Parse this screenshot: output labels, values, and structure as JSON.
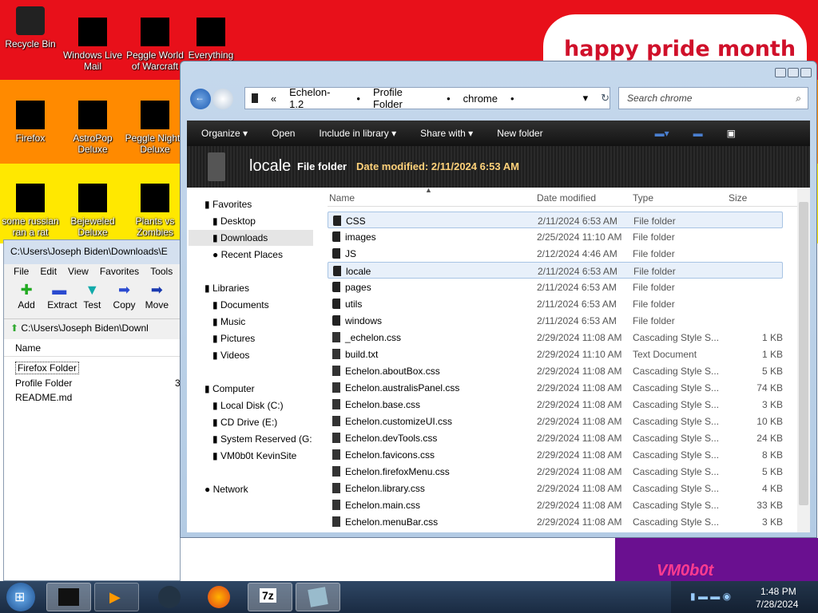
{
  "desktop": {
    "icons": [
      {
        "label": "Recycle Bin"
      },
      {
        "label": "Windows Live Mail"
      },
      {
        "label": "Peggle World of Warcraft"
      },
      {
        "label": "Everything"
      },
      {
        "label": "Firefox"
      },
      {
        "label": "AstroPop Deluxe"
      },
      {
        "label": "Peggle Nights Deluxe"
      },
      {
        "label": "some russian ran a rat"
      },
      {
        "label": "Bejeweled Deluxe"
      },
      {
        "label": "Plants vs Zombies"
      }
    ],
    "banner": "happy pride month",
    "colors": {
      "red": "#e8101a",
      "orange": "#ff8a00",
      "yellow": "#ffe800",
      "purple": "#6a1090"
    }
  },
  "zip": {
    "title": "C:\\Users\\Joseph Biden\\Downloads\\E",
    "menu": [
      "File",
      "Edit",
      "View",
      "Favorites",
      "Tools"
    ],
    "toolbar": [
      {
        "label": "Add",
        "icon": "plus-icon"
      },
      {
        "label": "Extract",
        "icon": "minus-icon"
      },
      {
        "label": "Test",
        "icon": "check-icon"
      },
      {
        "label": "Copy",
        "icon": "copy-icon"
      },
      {
        "label": "Move",
        "icon": "move-icon"
      }
    ],
    "address": "C:\\Users\\Joseph Biden\\Downl",
    "column": "Name",
    "rows": [
      "Firefox Folder",
      "Profile Folder",
      "README.md"
    ],
    "partial_value": "3"
  },
  "explorer": {
    "breadcrumbs": [
      "Echelon-1.2",
      "Profile Folder",
      "chrome"
    ],
    "search_placeholder": "Search chrome",
    "commands": [
      "Organize ▾",
      "Open",
      "Include in library ▾",
      "Share with ▾",
      "New folder"
    ],
    "details": {
      "name": "locale",
      "type": "File folder",
      "modified": "Date modified: 2/11/2024 6:53 AM"
    },
    "nav": {
      "favorites": "Favorites",
      "fav_items": [
        "Desktop",
        "Downloads",
        "Recent Places"
      ],
      "libraries": "Libraries",
      "lib_items": [
        "Documents",
        "Music",
        "Pictures",
        "Videos"
      ],
      "computer": "Computer",
      "comp_items": [
        "Local Disk (C:)",
        "CD Drive (E:)",
        "System Reserved (G:",
        "VM0b0t KevinSite"
      ],
      "network": "Network"
    },
    "columns": {
      "name": "Name",
      "date": "Date modified",
      "type": "Type",
      "size": "Size"
    },
    "files": [
      {
        "name": "CSS",
        "date": "2/11/2024 6:53 AM",
        "type": "File folder",
        "size": ""
      },
      {
        "name": "images",
        "date": "2/25/2024 11:10 AM",
        "type": "File folder",
        "size": ""
      },
      {
        "name": "JS",
        "date": "2/12/2024 4:46 AM",
        "type": "File folder",
        "size": ""
      },
      {
        "name": "locale",
        "date": "2/11/2024 6:53 AM",
        "type": "File folder",
        "size": ""
      },
      {
        "name": "pages",
        "date": "2/11/2024 6:53 AM",
        "type": "File folder",
        "size": ""
      },
      {
        "name": "utils",
        "date": "2/11/2024 6:53 AM",
        "type": "File folder",
        "size": ""
      },
      {
        "name": "windows",
        "date": "2/11/2024 6:53 AM",
        "type": "File folder",
        "size": ""
      },
      {
        "name": "_echelon.css",
        "date": "2/29/2024 11:08 AM",
        "type": "Cascading Style S...",
        "size": "1 KB"
      },
      {
        "name": "build.txt",
        "date": "2/29/2024 11:10 AM",
        "type": "Text Document",
        "size": "1 KB"
      },
      {
        "name": "Echelon.aboutBox.css",
        "date": "2/29/2024 11:08 AM",
        "type": "Cascading Style S...",
        "size": "5 KB"
      },
      {
        "name": "Echelon.australisPanel.css",
        "date": "2/29/2024 11:08 AM",
        "type": "Cascading Style S...",
        "size": "74 KB"
      },
      {
        "name": "Echelon.base.css",
        "date": "2/29/2024 11:08 AM",
        "type": "Cascading Style S...",
        "size": "3 KB"
      },
      {
        "name": "Echelon.customizeUI.css",
        "date": "2/29/2024 11:08 AM",
        "type": "Cascading Style S...",
        "size": "10 KB"
      },
      {
        "name": "Echelon.devTools.css",
        "date": "2/29/2024 11:08 AM",
        "type": "Cascading Style S...",
        "size": "24 KB"
      },
      {
        "name": "Echelon.favicons.css",
        "date": "2/29/2024 11:08 AM",
        "type": "Cascading Style S...",
        "size": "8 KB"
      },
      {
        "name": "Echelon.firefoxMenu.css",
        "date": "2/29/2024 11:08 AM",
        "type": "Cascading Style S...",
        "size": "5 KB"
      },
      {
        "name": "Echelon.library.css",
        "date": "2/29/2024 11:08 AM",
        "type": "Cascading Style S...",
        "size": "4 KB"
      },
      {
        "name": "Echelon.main.css",
        "date": "2/29/2024 11:08 AM",
        "type": "Cascading Style S...",
        "size": "33 KB"
      },
      {
        "name": "Echelon.menuBar.css",
        "date": "2/29/2024 11:08 AM",
        "type": "Cascading Style S...",
        "size": "3 KB"
      }
    ]
  },
  "taskbar": {
    "time": "1:48 PM",
    "date": "7/28/2024",
    "app_7z": "7z"
  },
  "watermark": "VM0b0t"
}
